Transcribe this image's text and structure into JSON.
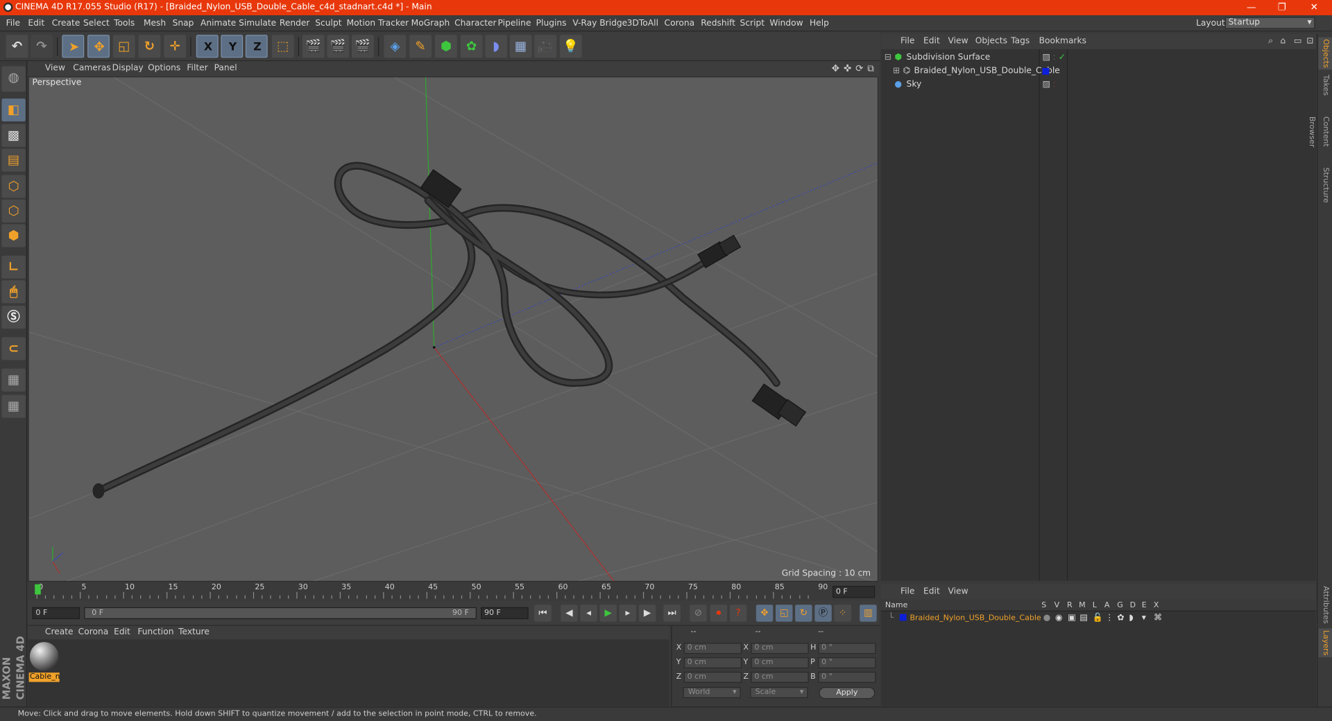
{
  "window": {
    "title": "CINEMA 4D R17.055 Studio (R17) - [Braided_Nylon_USB_Double_Cable_c4d_stadnart.c4d *] - Main",
    "minimize": "—",
    "restore": "❐",
    "close": "✕"
  },
  "menubar": {
    "items": [
      "File",
      "Edit",
      "Create",
      "Select",
      "Tools",
      "Mesh",
      "Snap",
      "Animate",
      "Simulate",
      "Render",
      "Sculpt",
      "Motion Tracker",
      "MoGraph",
      "Character",
      "Pipeline",
      "Plugins",
      "V-Ray Bridge",
      "3DToAll",
      "Corona",
      "Redshift",
      "Script",
      "Window",
      "Help"
    ],
    "layout_label": "Layout:",
    "layout_value": "Startup"
  },
  "toolbar": {
    "axis_x": "X",
    "axis_y": "Y",
    "axis_z": "Z"
  },
  "viewport": {
    "menu": [
      "View",
      "Cameras",
      "Display",
      "Options",
      "Filter",
      "Panel"
    ],
    "label": "Perspective",
    "grid_spacing": "Grid Spacing : 10 cm"
  },
  "timeline": {
    "ticks": [
      "0",
      "5",
      "10",
      "15",
      "20",
      "25",
      "30",
      "35",
      "40",
      "45",
      "50",
      "55",
      "60",
      "65",
      "70",
      "75",
      "80",
      "85",
      "90"
    ],
    "current_frame": "0 F",
    "start_field": "0 F",
    "range_start": "0 F",
    "range_end": "90 F",
    "end_field": "90 F"
  },
  "materials": {
    "menu": [
      "Create",
      "Corona",
      "Edit",
      "Function",
      "Texture"
    ],
    "items": [
      {
        "name": "Cable_m"
      }
    ]
  },
  "coordinates": {
    "header": [
      "--",
      "--",
      "--"
    ],
    "rows": [
      {
        "l1": "X",
        "v1": "0 cm",
        "l2": "X",
        "v2": "0 cm",
        "l3": "H",
        "v3": "0 °"
      },
      {
        "l1": "Y",
        "v1": "0 cm",
        "l2": "Y",
        "v2": "0 cm",
        "l3": "P",
        "v3": "0 °"
      },
      {
        "l1": "Z",
        "v1": "0 cm",
        "l2": "Z",
        "v2": "0 cm",
        "l3": "B",
        "v3": "0 °"
      }
    ],
    "mode": "World",
    "type": "Scale",
    "apply": "Apply"
  },
  "objects": {
    "menu": [
      "File",
      "Edit",
      "View",
      "Objects",
      "Tags",
      "Bookmarks"
    ],
    "items": [
      {
        "name": "Subdivision Surface",
        "icon": "subdivision-icon"
      },
      {
        "name": "Braided_Nylon_USB_Double_Cable",
        "icon": "polygon-object-icon"
      },
      {
        "name": "Sky",
        "icon": "sky-icon"
      }
    ]
  },
  "layers": {
    "menu": [
      "File",
      "Edit",
      "View"
    ],
    "columns": [
      "Name",
      "S",
      "V",
      "R",
      "M",
      "L",
      "A",
      "G",
      "D",
      "E",
      "X"
    ],
    "items": [
      {
        "name": "Braided_Nylon_USB_Double_Cable",
        "color": "#0d1fd8"
      }
    ]
  },
  "right_tabs": [
    "Objects",
    "Takes",
    "Content Browser",
    "Structure",
    "Attributes",
    "Layers"
  ],
  "brand": "MAXON CINEMA 4D",
  "status": "Move: Click and drag to move elements. Hold down SHIFT to quantize movement / add to the selection in point mode, CTRL to remove.",
  "colors": {
    "accent": "#e8380b",
    "highlight": "#f0a12a",
    "selection": "#5d6f85"
  }
}
